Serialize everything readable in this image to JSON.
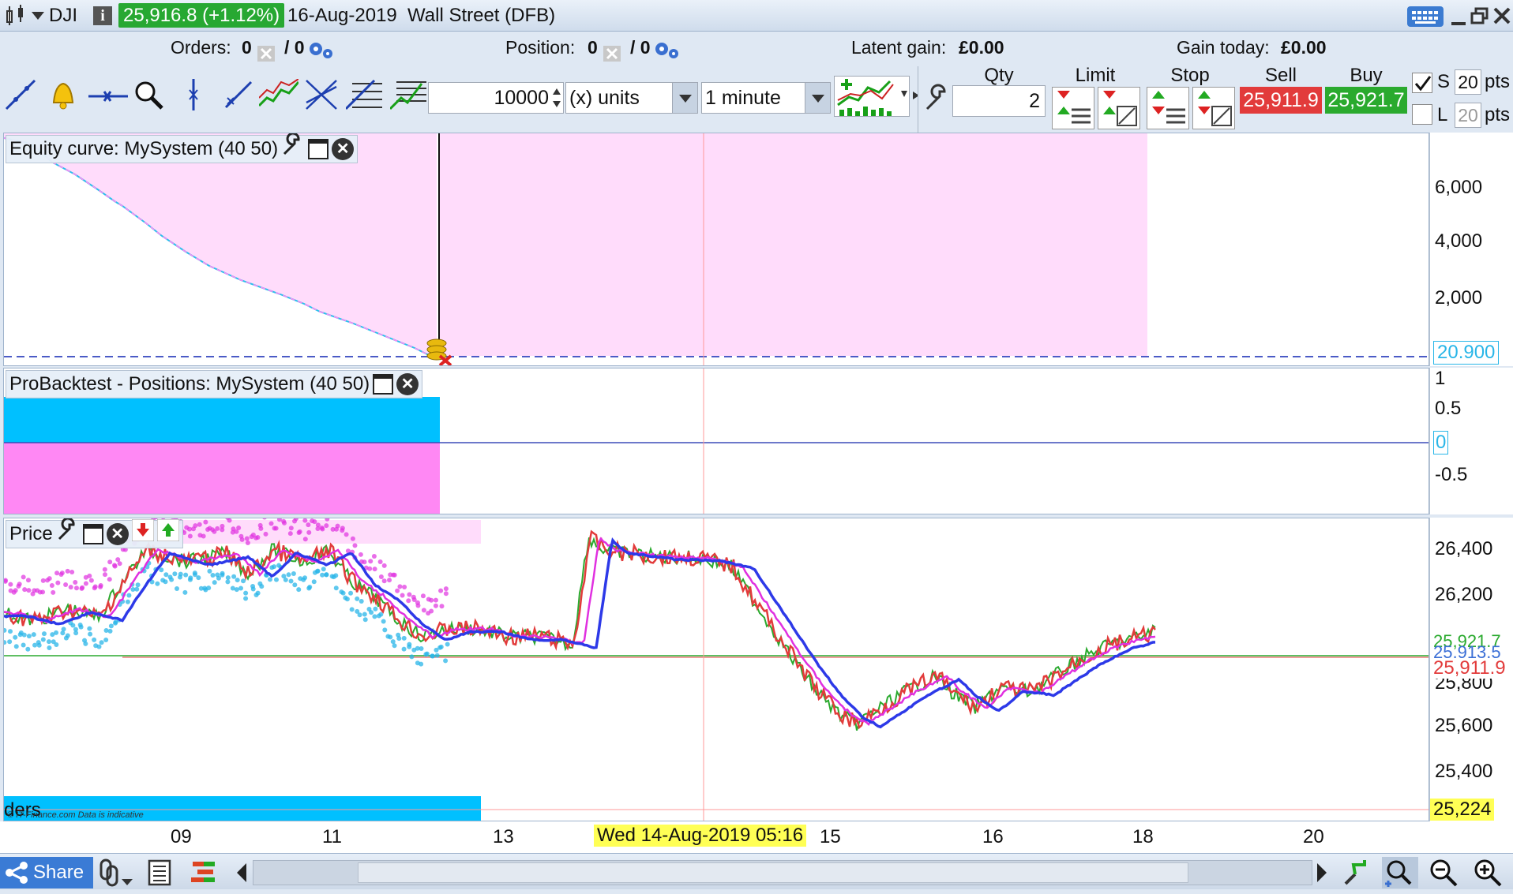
{
  "titlebar": {
    "symbol": "DJI",
    "info_icon": "info-icon",
    "price_change": "25,916.8 (+1.12%)",
    "date": "16-Aug-2019",
    "instrument": "Wall Street (DFB)"
  },
  "orders_row": {
    "orders_label": "Orders:",
    "orders_value": "0",
    "orders_value2": "/ 0",
    "position_label": "Position:",
    "position_value": "0",
    "position_value2": "/ 0",
    "latent_label": "Latent gain:",
    "latent_value": "£0.00",
    "gain_today_label": "Gain today:",
    "gain_today_value": "£0.00"
  },
  "toolbar": {
    "quantity_value": "10000",
    "units_select": "(x) units",
    "timeframe_select": "1 minute"
  },
  "trade_panel": {
    "qty_label": "Qty",
    "qty_value": "2",
    "limit_label": "Limit",
    "stop_label": "Stop",
    "sell_label": "Sell",
    "buy_label": "Buy",
    "sell_price": "25,911.9",
    "buy_price": "25,921.7",
    "s_label": "S",
    "s_value": "20",
    "s_unit": "pts",
    "l_label": "L",
    "l_value": "20",
    "l_unit": "pts",
    "s_checked": true,
    "l_checked": false
  },
  "equity_panel": {
    "title": "Equity curve: MySystem (40 50)",
    "axis_labels": [
      "6,000",
      "4,000",
      "2,000"
    ],
    "last_value": "20.900"
  },
  "positions_panel": {
    "title": "ProBacktest - Positions: MySystem (40 50)",
    "axis_labels": [
      "1",
      "0.5",
      "0",
      "-0.5"
    ]
  },
  "price_panel": {
    "title": "Price",
    "axis_labels": [
      "26,400",
      "26,200",
      "25,800",
      "25,600",
      "25,400"
    ],
    "tag_buy": "25,921.7",
    "tag_mid": "25,913.5",
    "tag_sell": "25,911.9",
    "tag_low": "25,224",
    "orders_text": "ders",
    "watermark": "© IT-Finance.com Data is indicative"
  },
  "x_axis": {
    "labels": [
      "09",
      "11",
      "13",
      "15",
      "16",
      "18",
      "20"
    ],
    "cursor_label": "Wed 14-Aug-2019 05:16"
  },
  "bottom_bar": {
    "share_label": "Share"
  },
  "colors": {
    "equity_area": "#ffdcfb",
    "long_fill": "#00c0ff",
    "short_fill": "#ff88f4",
    "sell_red": "#e23b3b",
    "buy_green": "#2aaa2e",
    "ma_blue": "#2d39e8",
    "ma_magenta": "#e030e0"
  }
}
